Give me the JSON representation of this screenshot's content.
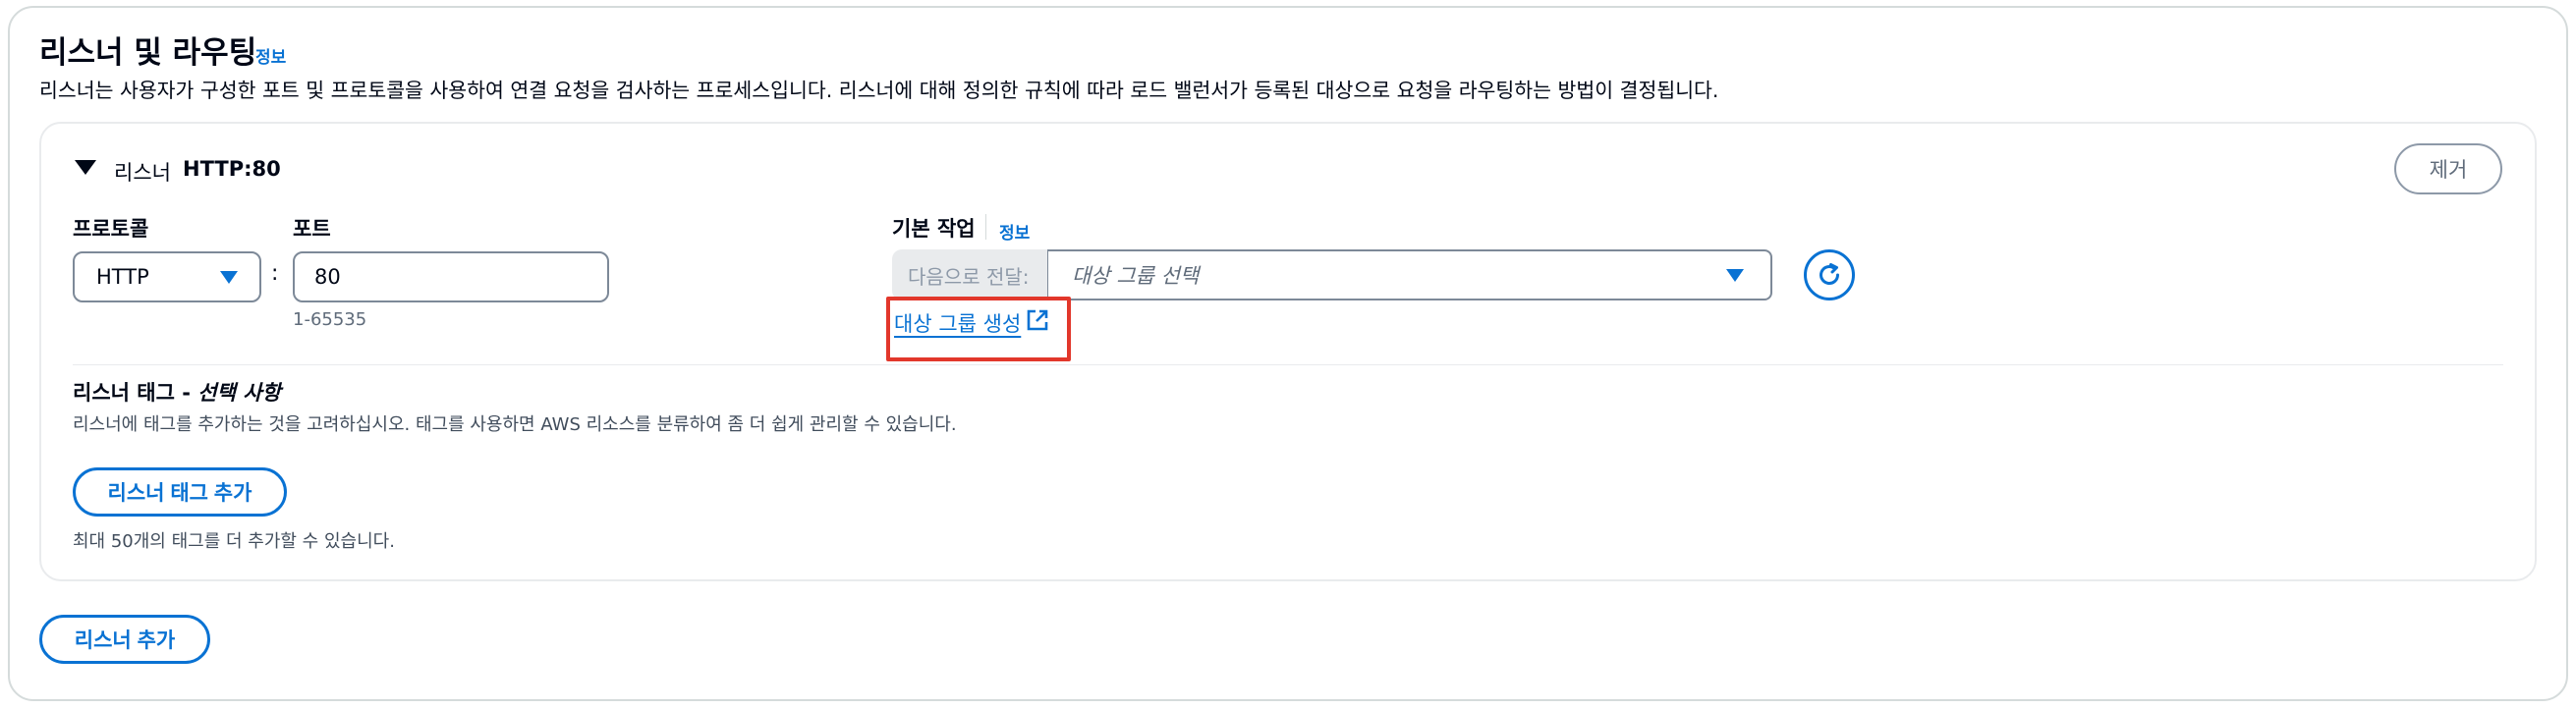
{
  "section": {
    "title": "리스너 및 라우팅",
    "info_label": "정보",
    "description": "리스너는 사용자가 구성한 포트 및 프로토콜을 사용하여 연결 요청을 검사하는 프로세스입니다. 리스너에 대해 정의한 규칙에 따라 로드 밸런서가 등록된 대상으로 요청을 라우팅하는 방법이 결정됩니다."
  },
  "listener": {
    "prefix": "리스너",
    "name": "HTTP:80",
    "remove_label": "제거",
    "protocol_label": "프로토콜",
    "protocol_value": "HTTP",
    "separator": ":",
    "port_label": "포트",
    "port_value": "80",
    "port_hint": "1-65535",
    "default_action_label": "기본 작업",
    "default_action_info": "정보",
    "forward_to_label": "다음으로 전달:",
    "target_group_placeholder": "대상 그룹 선택",
    "create_target_group_label": "대상 그룹 생성",
    "tags_title_bold": "리스너 태그 - ",
    "tags_title_italic": "선택 사항",
    "tags_description": "리스너에 태그를 추가하는 것을 고려하십시오. 태그를 사용하면 AWS 리소스를 분류하여 좀 더 쉽게 관리할 수 있습니다.",
    "add_tag_label": "리스너 태그 추가",
    "tag_limit_text": "최대 50개의 태그를 더 추가할 수 있습니다."
  },
  "add_listener_label": "리스너 추가",
  "icons": {
    "expand": "caret-down-icon",
    "protocol_dropdown": "triangle-down-icon",
    "target_dropdown": "triangle-down-icon",
    "refresh": "refresh-icon",
    "external_link": "external-link-icon"
  },
  "colors": {
    "link": "#0972d3",
    "highlight_box": "#e2372b",
    "text": "#000716",
    "muted": "#5f6b7a",
    "border": "#7d8998"
  }
}
